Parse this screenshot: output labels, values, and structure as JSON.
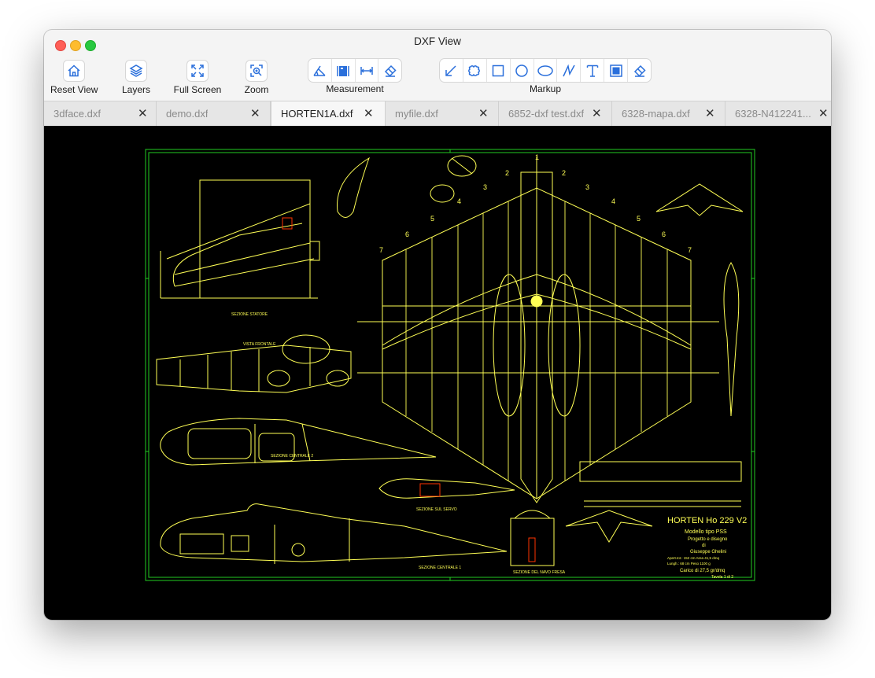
{
  "window": {
    "title": "DXF View"
  },
  "toolbar": {
    "reset_view": "Reset View",
    "layers": "Layers",
    "full_screen": "Full Screen",
    "zoom": "Zoom",
    "measurement_label": "Measurement",
    "markup_label": "Markup",
    "measurement_tools": [
      "angle-measure-icon",
      "area-measure-icon",
      "distance-measure-icon",
      "eraser-icon"
    ],
    "markup_tools": [
      "arrow-icon",
      "cloud-icon",
      "rectangle-icon",
      "circle-icon",
      "ellipse-icon",
      "polyline-icon",
      "text-icon",
      "filled-rectangle-icon",
      "eraser-icon"
    ]
  },
  "tabs": [
    {
      "name": "3dface.dxf",
      "active": false
    },
    {
      "name": "demo.dxf",
      "active": false
    },
    {
      "name": "HORTEN1A.dxf",
      "active": true
    },
    {
      "name": "myfile.dxf",
      "active": false
    },
    {
      "name": "6852-dxf test.dxf",
      "active": false
    },
    {
      "name": "6328-mapa.dxf",
      "active": false
    },
    {
      "name": "6328-N412241...",
      "active": false
    }
  ],
  "drawing": {
    "title_block": {
      "line1": "HORTEN Ho 229 V2",
      "line2": "Modello tipo PSS",
      "line3": "Progetto e disegno",
      "line4": "di",
      "line5": "Giuseppe Ghelini",
      "line6": "Apert.tot.: 152 cm    Area 41,5 dmq",
      "line7": "Lungh.:  68 cm     Peso 1100 g",
      "line8": "Carico di 27,5 gr/dmq",
      "line9": "Tavola 1 di 2"
    },
    "labels": {
      "section_stecca": "SEZIONE STATORE",
      "front_view": "VISTA FRONTALE",
      "section_centrale_2": "SEZIONE CENTRALE 2",
      "section_centrale_1": "SEZIONE CENTRALE 1",
      "section_servo": "SEZIONE SUL SERVO",
      "section_ala": "SEZIONE DEL NAVO FRESA"
    },
    "rib_numbers": [
      "1",
      "2",
      "2",
      "3",
      "3",
      "4",
      "4",
      "5",
      "5",
      "6",
      "6",
      "7",
      "7"
    ],
    "colors": {
      "lines": "#ffff55",
      "border": "#22cc22",
      "marker": "#ff3300"
    }
  }
}
